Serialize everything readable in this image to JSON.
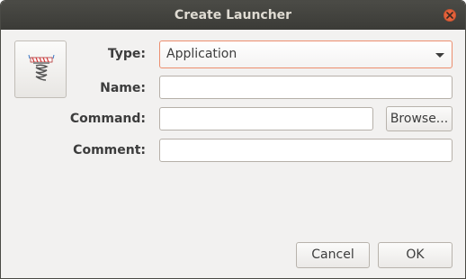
{
  "window": {
    "title": "Create Launcher"
  },
  "icons": {
    "close": "close-icon",
    "launcher": "launcher-spring-icon"
  },
  "form": {
    "type_label": "Type:",
    "type_value": "Application",
    "name_label": "Name:",
    "name_value": "",
    "command_label": "Command:",
    "command_value": "",
    "browse_label": "Browse...",
    "comment_label": "Comment:",
    "comment_value": ""
  },
  "actions": {
    "cancel_label": "Cancel",
    "ok_label": "OK"
  },
  "colors": {
    "titlebar": "#3c3b37",
    "close_button": "#e5613a",
    "focus_border": "#ec8e6e",
    "dialog_background": "#f2f1f0"
  }
}
